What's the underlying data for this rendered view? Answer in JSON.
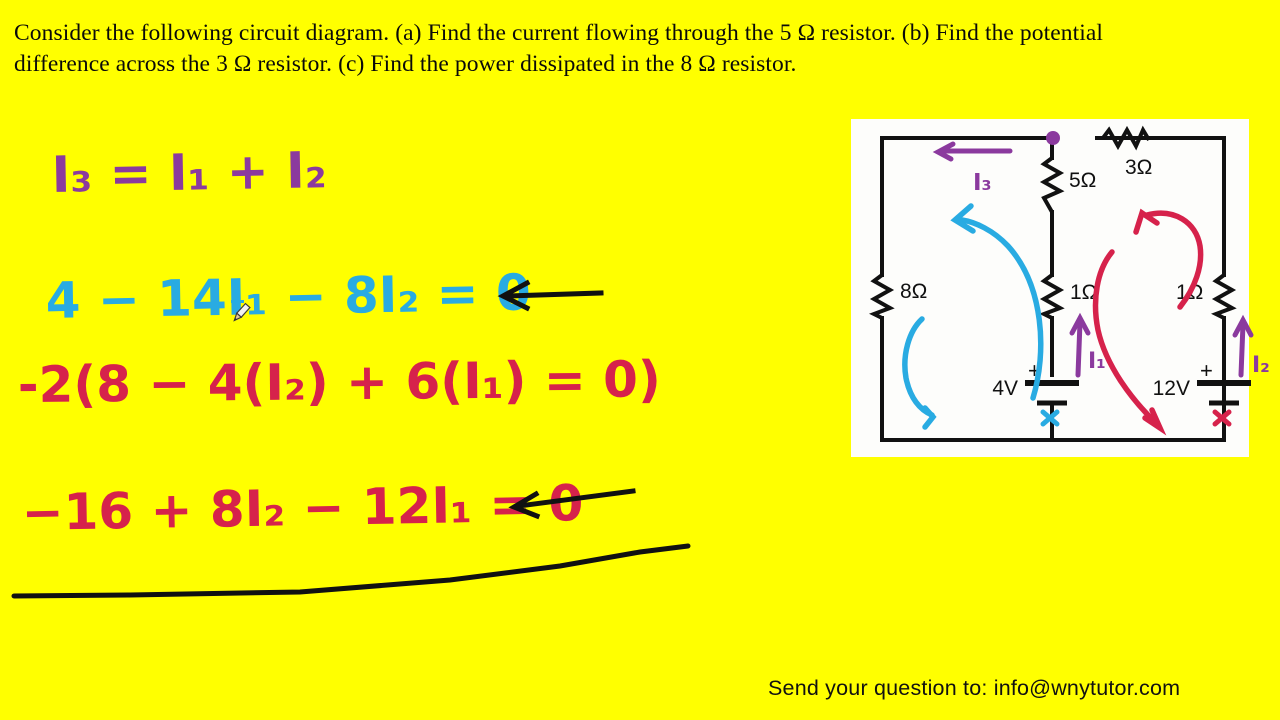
{
  "page": {
    "background_color": "#FFFF00",
    "prompt_text": "Consider the following circuit diagram. (a) Find the current flowing through the 5 Ω resistor. (b) Find the potential difference across the 3 Ω resistor. (c) Find the power dissipated in the 8 Ω resistor.",
    "footer_text": "Send your question to: info@wnytutor.com"
  },
  "colors": {
    "background": "#FFFF00",
    "purple_ink": "#8B3A9E",
    "cyan_ink": "#29ABE2",
    "red_ink": "#D6224B",
    "black_ink": "#111111",
    "text": "#0A0A0A",
    "board_white": "#FDFDFB"
  },
  "work": {
    "equations": [
      {
        "id": "eq1",
        "text": "I₃ = I₁ + I₂",
        "color": "purple"
      },
      {
        "id": "eq2",
        "text": "4 − 14I₁ − 8I₂ = 0",
        "color": "cyan"
      },
      {
        "id": "eq3",
        "text": "-2(8 − 4(I₂) + 6(I₁) = 0)",
        "color": "red"
      },
      {
        "id": "eq4",
        "text": "−16 + 8I₂ − 12I₁ = 0",
        "color": "red"
      }
    ],
    "annotations": [
      {
        "id": "arrow-to-eq2",
        "type": "left-arrow",
        "color": "black"
      },
      {
        "id": "arrow-to-eq4",
        "type": "left-arrow",
        "color": "black"
      },
      {
        "id": "underline-stroke",
        "type": "long-line",
        "color": "black"
      }
    ],
    "cursor": "pencil-cursor"
  },
  "circuit": {
    "title": "circuit-diagram",
    "components": [
      {
        "id": "r8",
        "label": "8Ω",
        "type": "resistor",
        "orientation": "vertical"
      },
      {
        "id": "r5",
        "label": "5Ω",
        "type": "resistor",
        "orientation": "vertical"
      },
      {
        "id": "r3",
        "label": "3Ω",
        "type": "resistor",
        "orientation": "horizontal"
      },
      {
        "id": "r1a",
        "label": "1Ω",
        "type": "resistor",
        "orientation": "vertical"
      },
      {
        "id": "r1b",
        "label": "1Ω",
        "type": "resistor",
        "orientation": "vertical"
      },
      {
        "id": "bat4",
        "label": "4V",
        "type": "battery",
        "polarity": "+"
      },
      {
        "id": "bat12",
        "label": "12V",
        "type": "battery",
        "polarity": "+"
      }
    ],
    "polarity_marks": [
      "+",
      "+"
    ],
    "current_labels": [
      {
        "id": "i3",
        "label": "I₃",
        "color": "purple",
        "direction": "left"
      },
      {
        "id": "i1",
        "label": "I₁",
        "color": "purple",
        "direction": "up"
      },
      {
        "id": "i2",
        "label": "I₂",
        "color": "purple",
        "direction": "up"
      }
    ],
    "loops": [
      {
        "id": "loop-left",
        "color": "cyan",
        "direction": "counter-clockwise"
      },
      {
        "id": "loop-right",
        "color": "red",
        "direction": "counter-clockwise"
      }
    ],
    "x_marks": [
      {
        "id": "x-mark-left",
        "color": "cyan"
      },
      {
        "id": "x-mark-right",
        "color": "red"
      }
    ],
    "node_dot": {
      "id": "junction-node",
      "color": "purple"
    }
  }
}
